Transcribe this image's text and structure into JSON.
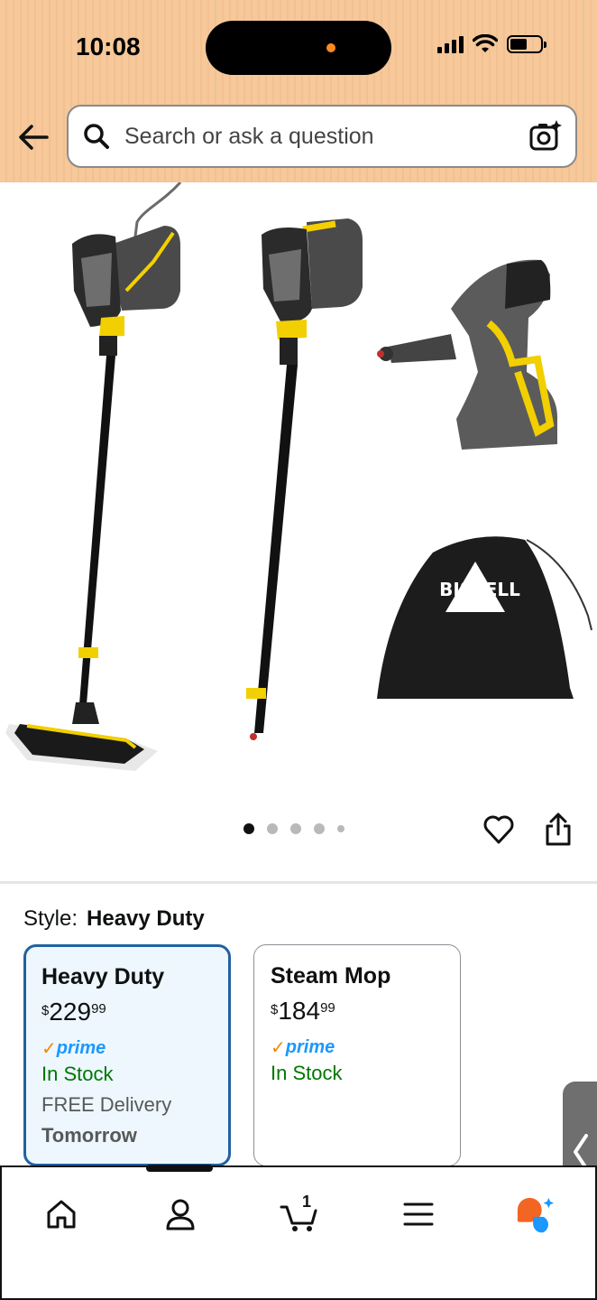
{
  "status_bar": {
    "time": "10:08"
  },
  "header": {
    "search_placeholder": "Search or ask a question",
    "back_icon": "arrow-left-icon",
    "search_icon": "magnifier-icon",
    "camera_icon": "camera-sparkle-icon",
    "background_color": "#f6c89a"
  },
  "gallery": {
    "image_count": 5,
    "active_index": 0,
    "brand_on_bag": "BISSELL"
  },
  "style_selector": {
    "label": "Style:",
    "selected_value": "Heavy Duty",
    "options": [
      {
        "name": "Heavy Duty",
        "price_symbol": "$",
        "price_whole": "229",
        "price_fraction": "99",
        "prime_label": "prime",
        "stock": "In Stock",
        "delivery": "FREE Delivery",
        "delivery_day": "Tomorrow",
        "selected": true
      },
      {
        "name": "Steam Mop",
        "price_symbol": "$",
        "price_whole": "184",
        "price_fraction": "99",
        "prime_label": "prime",
        "stock": "In Stock",
        "selected": false
      }
    ]
  },
  "bottom_nav": {
    "cart_count": "1",
    "items": [
      "home-icon",
      "account-icon",
      "cart-icon",
      "menu-icon",
      "rufus-assistant-icon"
    ]
  },
  "colors": {
    "selected_border": "#2162a1",
    "selected_bg": "#edf7fd",
    "in_stock": "#007600",
    "prime_blue": "#1a98ff",
    "prime_check": "#f08804"
  }
}
